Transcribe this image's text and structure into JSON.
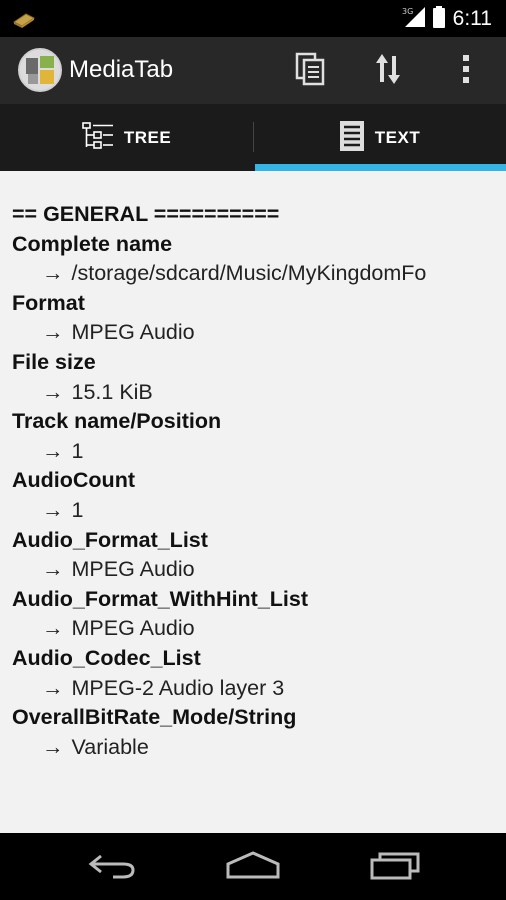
{
  "status_bar": {
    "time": "6:11",
    "network_badge": "3G",
    "icons": [
      "notification-book-icon",
      "signal-icon",
      "battery-icon"
    ]
  },
  "action_bar": {
    "title": "MediaTab",
    "actions": [
      "copy-icon",
      "sort-arrows-icon",
      "overflow-menu-icon"
    ]
  },
  "tabs": [
    {
      "label": "TREE",
      "icon": "tree-view-icon",
      "selected": false
    },
    {
      "label": "TEXT",
      "icon": "text-document-icon",
      "selected": true
    }
  ],
  "content": {
    "header": "== GENERAL ==========",
    "arrow": "→",
    "fields": [
      {
        "name": "Complete name",
        "value": "/storage/sdcard/Music/MyKingdomFo"
      },
      {
        "name": "Format",
        "value": "MPEG Audio"
      },
      {
        "name": "File size",
        "value": "15.1 KiB"
      },
      {
        "name": "Track name/Position",
        "value": "1"
      },
      {
        "name": "AudioCount",
        "value": "1"
      },
      {
        "name": "Audio_Format_List",
        "value": "MPEG Audio"
      },
      {
        "name": "Audio_Format_WithHint_List",
        "value": "MPEG Audio"
      },
      {
        "name": "Audio_Codec_List",
        "value": "MPEG-2 Audio layer 3"
      },
      {
        "name": "OverallBitRate_Mode/String",
        "value": "Variable"
      }
    ]
  },
  "nav_bar": {
    "buttons": [
      "back-icon",
      "home-icon",
      "recent-apps-icon"
    ]
  },
  "colors": {
    "tab_indicator": "#33b5e5",
    "action_bar": "#282828",
    "content_bg": "#f2f2f2"
  }
}
